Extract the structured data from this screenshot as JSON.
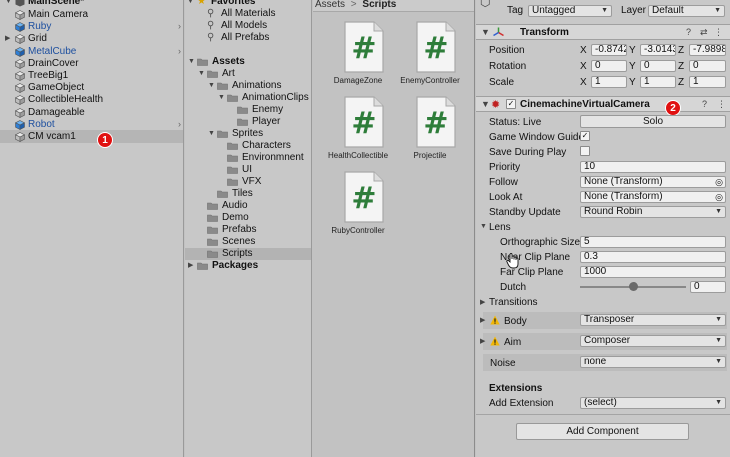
{
  "hierarchy": {
    "scene_name": "MainScene*",
    "items": [
      {
        "label": "Main Camera",
        "blue": false,
        "chevron": false
      },
      {
        "label": "Ruby",
        "blue": true,
        "chevron": true
      },
      {
        "label": "Grid",
        "blue": false,
        "chevron": false
      },
      {
        "label": "MetalCube",
        "blue": true,
        "chevron": true
      },
      {
        "label": "DrainCover",
        "blue": false,
        "chevron": false
      },
      {
        "label": "TreeBig1",
        "blue": false,
        "chevron": false
      },
      {
        "label": "GameObject",
        "blue": false,
        "chevron": false
      },
      {
        "label": "CollectibleHealth",
        "blue": false,
        "chevron": false
      },
      {
        "label": "Damageable",
        "blue": false,
        "chevron": false
      },
      {
        "label": "Robot",
        "blue": true,
        "chevron": true
      },
      {
        "label": "CM vcam1",
        "blue": false,
        "chevron": false
      }
    ],
    "badge": "1"
  },
  "project": {
    "favorites": {
      "label": "Favorites",
      "items": [
        "All Materials",
        "All Models",
        "All Prefabs"
      ]
    },
    "tree": {
      "assets": "Assets",
      "art": "Art",
      "animations": "Animations",
      "animation_clips": "AnimationClips",
      "enemy": "Enemy",
      "player": "Player",
      "sprites": "Sprites",
      "characters": "Characters",
      "environment": "Environmnent",
      "ui": "UI",
      "vfx": "VFX",
      "tiles": "Tiles",
      "audio": "Audio",
      "demo": "Demo",
      "prefabs": "Prefabs",
      "scenes": "Scenes",
      "scripts": "Scripts",
      "packages": "Packages"
    },
    "breadcrumb": {
      "root": "Assets",
      "sep": ">",
      "current": "Scripts"
    },
    "assets": [
      {
        "name": "DamageZone",
        "glyph": "#"
      },
      {
        "name": "EnemyController",
        "glyph": "#"
      },
      {
        "name": "HealthCollectible",
        "glyph": "#"
      },
      {
        "name": "Projectile",
        "glyph": "#"
      },
      {
        "name": "RubyController",
        "glyph": "#"
      }
    ]
  },
  "inspector": {
    "tag_label": "Tag",
    "tag_value": "Untagged",
    "layer_label": "Layer",
    "layer_value": "Default",
    "transform": {
      "title": "Transform",
      "position_label": "Position",
      "rotation_label": "Rotation",
      "scale_label": "Scale",
      "position": {
        "x": "-0.8742",
        "y": "-3.0143",
        "z": "-7.9898"
      },
      "rotation": {
        "x": "0",
        "y": "0",
        "z": "0"
      },
      "scale": {
        "x": "1",
        "y": "1",
        "z": "1"
      },
      "axis_x": "X",
      "axis_y": "Y",
      "axis_z": "Z"
    },
    "vcam": {
      "title": "CinemachineVirtualCamera",
      "badge": "2",
      "status_label": "Status: Live",
      "solo_button": "Solo",
      "game_window_guides_label": "Game Window Guides",
      "save_during_play_label": "Save During Play",
      "priority_label": "Priority",
      "priority_value": "10",
      "follow_label": "Follow",
      "follow_value": "None (Transform)",
      "look_at_label": "Look At",
      "look_at_value": "None (Transform)",
      "standby_label": "Standby Update",
      "standby_value": "Round Robin",
      "lens_label": "Lens",
      "ortho_label": "Orthographic Size",
      "ortho_value": "5",
      "near_label": "Near Clip Plane",
      "near_value": "0.3",
      "far_label": "Far Clip Plane",
      "far_value": "1000",
      "dutch_label": "Dutch",
      "dutch_value": "0",
      "dutch_fraction": 0.5,
      "transitions_label": "Transitions",
      "body_label": "Body",
      "body_value": "Transposer",
      "aim_label": "Aim",
      "aim_value": "Composer",
      "noise_label": "Noise",
      "noise_value": "none",
      "extensions_label": "Extensions",
      "add_extension_label": "Add Extension",
      "add_extension_value": "(select)"
    },
    "add_component": "Add Component"
  },
  "colors": {
    "script_green": "#2e7d3a",
    "badge_red": "#e01010",
    "prefab_blue": "#1d4f9f",
    "cube_blue": "#3a8fe0",
    "warn_yellow": "#f2b705"
  }
}
